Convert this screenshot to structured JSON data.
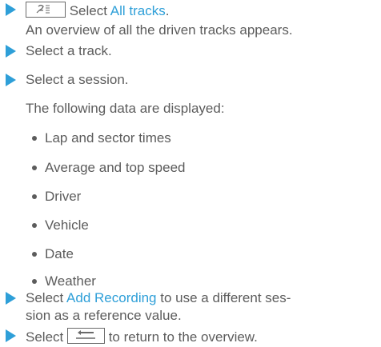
{
  "steps": [
    {
      "before": "",
      "icon": "overview-tracks-icon",
      "text_pre": " Select ",
      "link": "All tracks",
      "text_post": ".",
      "result": "An overview of all the driven tracks appears."
    },
    {
      "text": "Select a track."
    },
    {
      "text": "Select a session.",
      "result": "The following data are displayed:",
      "bullets": [
        "Lap and sector times",
        "Average and top speed",
        "Driver",
        "Vehicle",
        "Date",
        "Weather"
      ]
    },
    {
      "text_pre": "Select ",
      "link": "Add Recording",
      "text_post": " to use a different ses-",
      "line2": "sion as a reference value."
    },
    {
      "text_pre": "Select ",
      "icon": "back-icon",
      "text_post": " to return to the overview."
    }
  ],
  "colors": {
    "accent": "#2e9fd8",
    "text": "#5c5c5c"
  }
}
